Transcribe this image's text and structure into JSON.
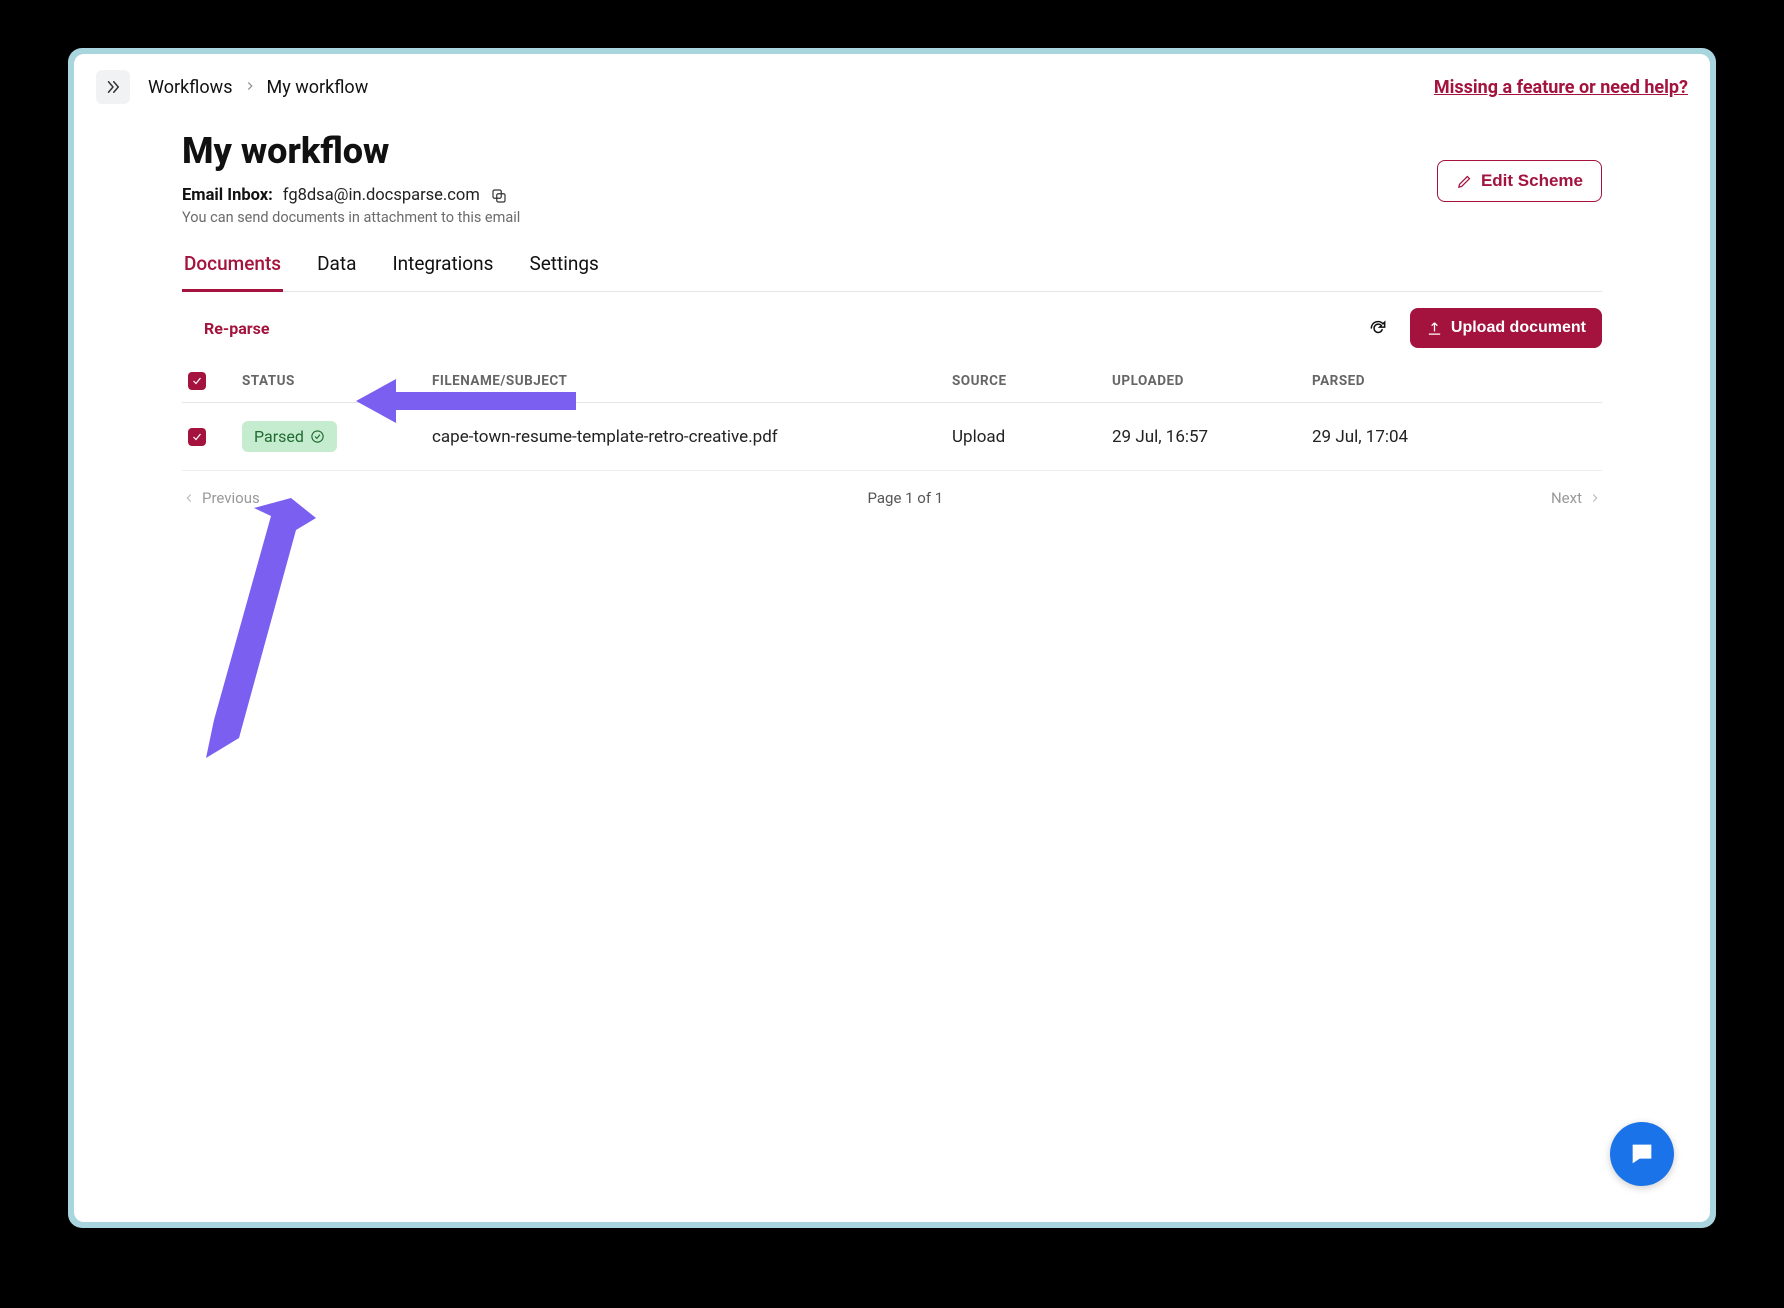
{
  "breadcrumb": {
    "root": "Workflows",
    "current": "My workflow"
  },
  "help_link": "Missing a feature or need help?",
  "page_title": "My workflow",
  "email": {
    "label": "Email Inbox:",
    "value": "fg8dsa@in.docsparse.com",
    "hint": "You can send documents in attachment to this email"
  },
  "edit_scheme_label": "Edit Scheme",
  "tabs": [
    {
      "label": "Documents",
      "active": true
    },
    {
      "label": "Data",
      "active": false
    },
    {
      "label": "Integrations",
      "active": false
    },
    {
      "label": "Settings",
      "active": false
    }
  ],
  "actions": {
    "reparse": "Re-parse",
    "upload": "Upload document"
  },
  "table": {
    "headers": {
      "status": "STATUS",
      "filename": "FILENAME/SUBJECT",
      "source": "SOURCE",
      "uploaded": "UPLOADED",
      "parsed": "PARSED"
    },
    "rows": [
      {
        "checked": true,
        "status": "Parsed",
        "filename": "cape-town-resume-template-retro-creative.pdf",
        "source": "Upload",
        "uploaded": "29 Jul, 16:57",
        "parsed": "29 Jul, 17:04"
      }
    ]
  },
  "pager": {
    "prev": "Previous",
    "label": "Page 1 of 1",
    "next": "Next"
  },
  "colors": {
    "brand": "#a3133d",
    "arrow": "#7a5ff0",
    "badge_bg": "#c5eccf",
    "chat": "#1a73e8"
  }
}
